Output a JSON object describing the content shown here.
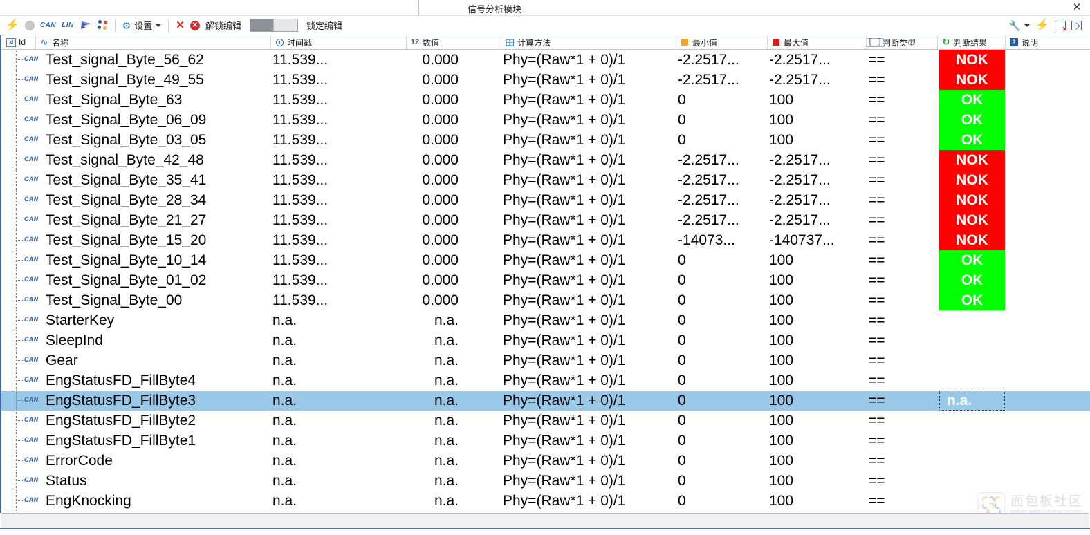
{
  "window": {
    "title": "信号分析模块",
    "close_label": "✕"
  },
  "toolbar": {
    "bolt_label": "",
    "circle_label": "",
    "can_label": "CAN",
    "lin_label": "LIN",
    "flag_label": "",
    "dots_label": "",
    "settings_label": "设置",
    "close_x_label": "✕",
    "error_label": "✕",
    "unlock_label": "解锁编辑",
    "lock_label": "锁定编辑",
    "wrench_label": "",
    "bolt2_label": "",
    "panel_label": "",
    "popout_label": ""
  },
  "columns": [
    {
      "key": "id",
      "label": "Id",
      "icon": "id-icon"
    },
    {
      "key": "name",
      "label": "名称",
      "icon": "waveform-icon"
    },
    {
      "key": "ts",
      "label": "时间戳",
      "icon": "clock-icon"
    },
    {
      "key": "val",
      "label": "数值",
      "icon": "number-12-icon"
    },
    {
      "key": "calc",
      "label": "计算方法",
      "icon": "grid-icon"
    },
    {
      "key": "min",
      "label": "最小值",
      "icon": "orange-square-icon"
    },
    {
      "key": "max",
      "label": "最大值",
      "icon": "red-square-icon"
    },
    {
      "key": "type",
      "label": "判断类型",
      "icon": "bracket-icon"
    },
    {
      "key": "res",
      "label": "判断结果",
      "icon": "refresh-icon"
    },
    {
      "key": "desc",
      "label": "说明",
      "icon": "help-icon"
    }
  ],
  "bus_tag": "CAN",
  "rows": [
    {
      "name": "Test_signal_Byte_56_62",
      "ts": "11.539...",
      "val": "0.000",
      "calc": "Phy=(Raw*1 + 0)/1",
      "min": "-2.2517...",
      "max": "-2.2517...",
      "type": "==",
      "res": "NOK",
      "res_state": "nok"
    },
    {
      "name": "Test_signal_Byte_49_55",
      "ts": "11.539...",
      "val": "0.000",
      "calc": "Phy=(Raw*1 + 0)/1",
      "min": "-2.2517...",
      "max": "-2.2517...",
      "type": "==",
      "res": "NOK",
      "res_state": "nok"
    },
    {
      "name": "Test_Signal_Byte_63",
      "ts": "11.539...",
      "val": "0.000",
      "calc": "Phy=(Raw*1 + 0)/1",
      "min": "0",
      "max": "100",
      "type": "==",
      "res": "OK",
      "res_state": "ok"
    },
    {
      "name": "Test_Signal_Byte_06_09",
      "ts": "11.539...",
      "val": "0.000",
      "calc": "Phy=(Raw*1 + 0)/1",
      "min": "0",
      "max": "100",
      "type": "==",
      "res": "OK",
      "res_state": "ok"
    },
    {
      "name": "Test_Signal_Byte_03_05",
      "ts": "11.539...",
      "val": "0.000",
      "calc": "Phy=(Raw*1 + 0)/1",
      "min": "0",
      "max": "100",
      "type": "==",
      "res": "OK",
      "res_state": "ok"
    },
    {
      "name": "Test_signal_Byte_42_48",
      "ts": "11.539...",
      "val": "0.000",
      "calc": "Phy=(Raw*1 + 0)/1",
      "min": "-2.2517...",
      "max": "-2.2517...",
      "type": "==",
      "res": "NOK",
      "res_state": "nok"
    },
    {
      "name": "Test_Signal_Byte_35_41",
      "ts": "11.539...",
      "val": "0.000",
      "calc": "Phy=(Raw*1 + 0)/1",
      "min": "-2.2517...",
      "max": "-2.2517...",
      "type": "==",
      "res": "NOK",
      "res_state": "nok"
    },
    {
      "name": "Test_Signal_Byte_28_34",
      "ts": "11.539...",
      "val": "0.000",
      "calc": "Phy=(Raw*1 + 0)/1",
      "min": "-2.2517...",
      "max": "-2.2517...",
      "type": "==",
      "res": "NOK",
      "res_state": "nok"
    },
    {
      "name": "Test_Signal_Byte_21_27",
      "ts": "11.539...",
      "val": "0.000",
      "calc": "Phy=(Raw*1 + 0)/1",
      "min": "-2.2517...",
      "max": "-2.2517...",
      "type": "==",
      "res": "NOK",
      "res_state": "nok"
    },
    {
      "name": "Test_Signal_Byte_15_20",
      "ts": "11.539...",
      "val": "0.000",
      "calc": "Phy=(Raw*1 + 0)/1",
      "min": "-14073...",
      "max": "-140737...",
      "type": "==",
      "res": "NOK",
      "res_state": "nok"
    },
    {
      "name": "Test_Signal_Byte_10_14",
      "ts": "11.539...",
      "val": "0.000",
      "calc": "Phy=(Raw*1 + 0)/1",
      "min": "0",
      "max": "100",
      "type": "==",
      "res": "OK",
      "res_state": "ok"
    },
    {
      "name": "Test_Signal_Byte_01_02",
      "ts": "11.539...",
      "val": "0.000",
      "calc": "Phy=(Raw*1 + 0)/1",
      "min": "0",
      "max": "100",
      "type": "==",
      "res": "OK",
      "res_state": "ok"
    },
    {
      "name": "Test_Signal_Byte_00",
      "ts": "11.539...",
      "val": "0.000",
      "calc": "Phy=(Raw*1 + 0)/1",
      "min": "0",
      "max": "100",
      "type": "==",
      "res": "OK",
      "res_state": "ok"
    },
    {
      "name": "StarterKey",
      "ts": "n.a.",
      "val": "n.a.",
      "calc": "Phy=(Raw*1 + 0)/1",
      "min": "0",
      "max": "100",
      "type": "==",
      "res": "",
      "res_state": "none"
    },
    {
      "name": "SleepInd",
      "ts": "n.a.",
      "val": "n.a.",
      "calc": "Phy=(Raw*1 + 0)/1",
      "min": "0",
      "max": "100",
      "type": "==",
      "res": "",
      "res_state": "none"
    },
    {
      "name": "Gear",
      "ts": "n.a.",
      "val": "n.a.",
      "calc": "Phy=(Raw*1 + 0)/1",
      "min": "0",
      "max": "100",
      "type": "==",
      "res": "",
      "res_state": "none"
    },
    {
      "name": "EngStatusFD_FillByte4",
      "ts": "n.a.",
      "val": "n.a.",
      "calc": "Phy=(Raw*1 + 0)/1",
      "min": "0",
      "max": "100",
      "type": "==",
      "res": "",
      "res_state": "none"
    },
    {
      "name": "EngStatusFD_FillByte3",
      "ts": "n.a.",
      "val": "n.a.",
      "calc": "Phy=(Raw*1 + 0)/1",
      "min": "0",
      "max": "100",
      "type": "==",
      "res": "n.a.",
      "res_state": "selected",
      "selected": true
    },
    {
      "name": "EngStatusFD_FillByte2",
      "ts": "n.a.",
      "val": "n.a.",
      "calc": "Phy=(Raw*1 + 0)/1",
      "min": "0",
      "max": "100",
      "type": "==",
      "res": "",
      "res_state": "none"
    },
    {
      "name": "EngStatusFD_FillByte1",
      "ts": "n.a.",
      "val": "n.a.",
      "calc": "Phy=(Raw*1 + 0)/1",
      "min": "0",
      "max": "100",
      "type": "==",
      "res": "",
      "res_state": "none"
    },
    {
      "name": "ErrorCode",
      "ts": "n.a.",
      "val": "n.a.",
      "calc": "Phy=(Raw*1 + 0)/1",
      "min": "0",
      "max": "100",
      "type": "==",
      "res": "",
      "res_state": "none"
    },
    {
      "name": "Status",
      "ts": "n.a.",
      "val": "n.a.",
      "calc": "Phy=(Raw*1 + 0)/1",
      "min": "0",
      "max": "100",
      "type": "==",
      "res": "",
      "res_state": "none"
    },
    {
      "name": "EngKnocking",
      "ts": "n.a.",
      "val": "n.a.",
      "calc": "Phy=(Raw*1 + 0)/1",
      "min": "0",
      "max": "100",
      "type": "==",
      "res": "",
      "res_state": "none"
    }
  ],
  "colors": {
    "nok_bg": "#FF0000",
    "ok_bg": "#00FF00",
    "selection": "#9AC8E8",
    "accent": "#3A6EA5",
    "badge_text": "#FFFFFF"
  },
  "watermark": {
    "cn": "面包板社区",
    "en": "mbb.eet-china.com"
  }
}
